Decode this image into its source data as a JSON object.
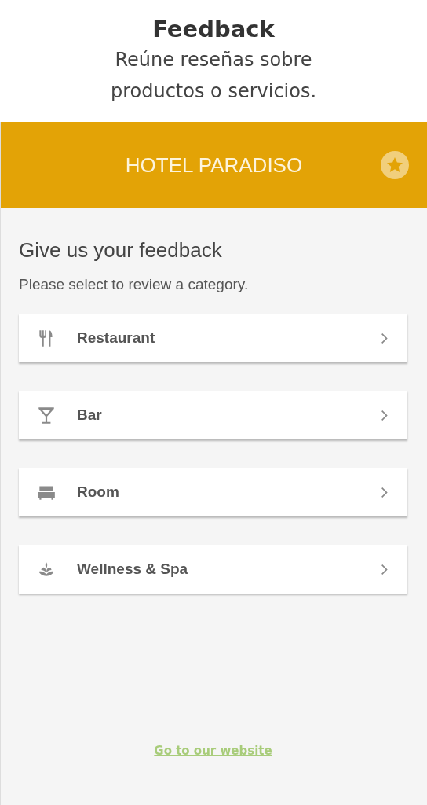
{
  "caption": {
    "title": "Feedback",
    "subtitle": "Reúne reseñas sobre productos o servicios."
  },
  "app_bar": {
    "title": "HOTEL PARADISO"
  },
  "heading": "Give us your feedback",
  "instruction": "Please select to review a category.",
  "categories": [
    {
      "label": "Restaurant",
      "kind": "restaurant"
    },
    {
      "label": "Bar",
      "kind": "bar"
    },
    {
      "label": "Room",
      "kind": "room"
    },
    {
      "label": "Wellness & Spa",
      "kind": "spa"
    }
  ],
  "footer_link": "Go to our website"
}
